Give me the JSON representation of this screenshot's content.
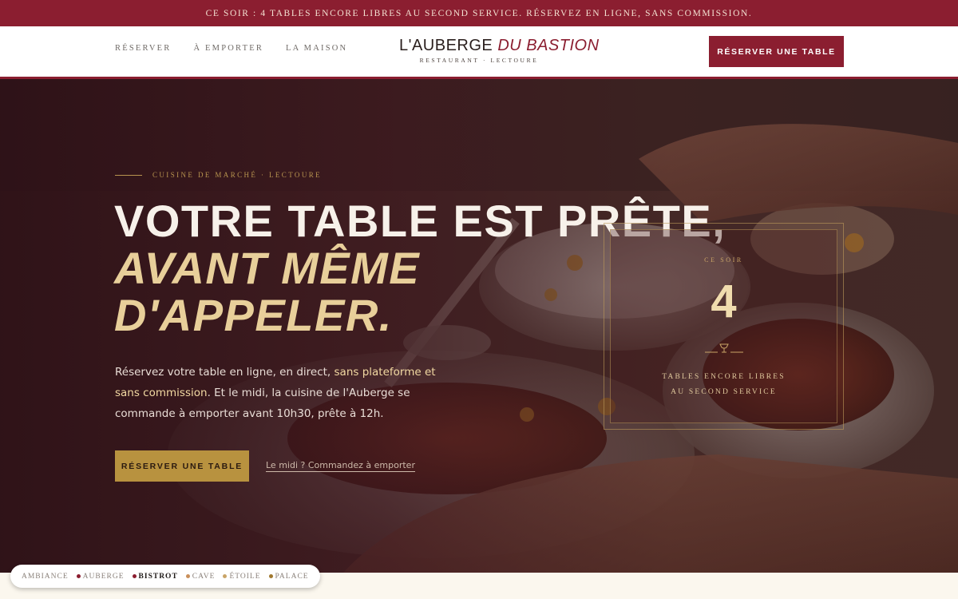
{
  "announcement": "CE SOIR : 4 TABLES ENCORE LIBRES AU SECOND SERVICE. RÉSERVEZ EN LIGNE, SANS COMMISSION.",
  "nav": {
    "links": [
      "RÉSERVER",
      "À EMPORTER",
      "LA MAISON"
    ],
    "brand_main": "L'AUBERGE",
    "brand_accent": "DU BASTION",
    "brand_sub": "RESTAURANT · LECTOURE",
    "cta": "RÉSERVER UNE TABLE"
  },
  "hero": {
    "eyebrow": "CUISINE DE MARCHÉ · LECTOURE",
    "headline_line1": "VOTRE TABLE EST PRÊTE,",
    "headline_line2": "AVANT MÊME",
    "headline_line3": "D'APPELER.",
    "intro_part1": "Réservez votre table en ligne, en direct, ",
    "intro_highlight": "sans plateforme et sans commission",
    "intro_part2": ". Et le midi, la cuisine de l'Auberge se commande à emporter avant 10h30, prête à 12h.",
    "cta": "RÉSERVER UNE TABLE",
    "secondary_link": "Le midi ? Commandez à emporter"
  },
  "availability_card": {
    "label": "CE SOIR",
    "number": "4",
    "icon": "wine-glass-icon",
    "caption_line1": "TABLES ENCORE LIBRES",
    "caption_line2": "AU SECOND SERVICE"
  },
  "themes": {
    "items": [
      {
        "label": "AMBIANCE",
        "dot": ""
      },
      {
        "label": "AUBERGE",
        "dot": "#8b1e30"
      },
      {
        "label": "BISTROT",
        "dot": "#8b1e30"
      },
      {
        "label": "CAVE",
        "dot": "#c98f5a"
      },
      {
        "label": "ÉTOILE",
        "dot": "#c9a467"
      },
      {
        "label": "PALACE",
        "dot": "#a0782e"
      }
    ],
    "active": "BISTROT"
  },
  "colors": {
    "brand_red": "#8b1e30",
    "gold": "#b8923f",
    "cream": "#e8cf9a"
  }
}
